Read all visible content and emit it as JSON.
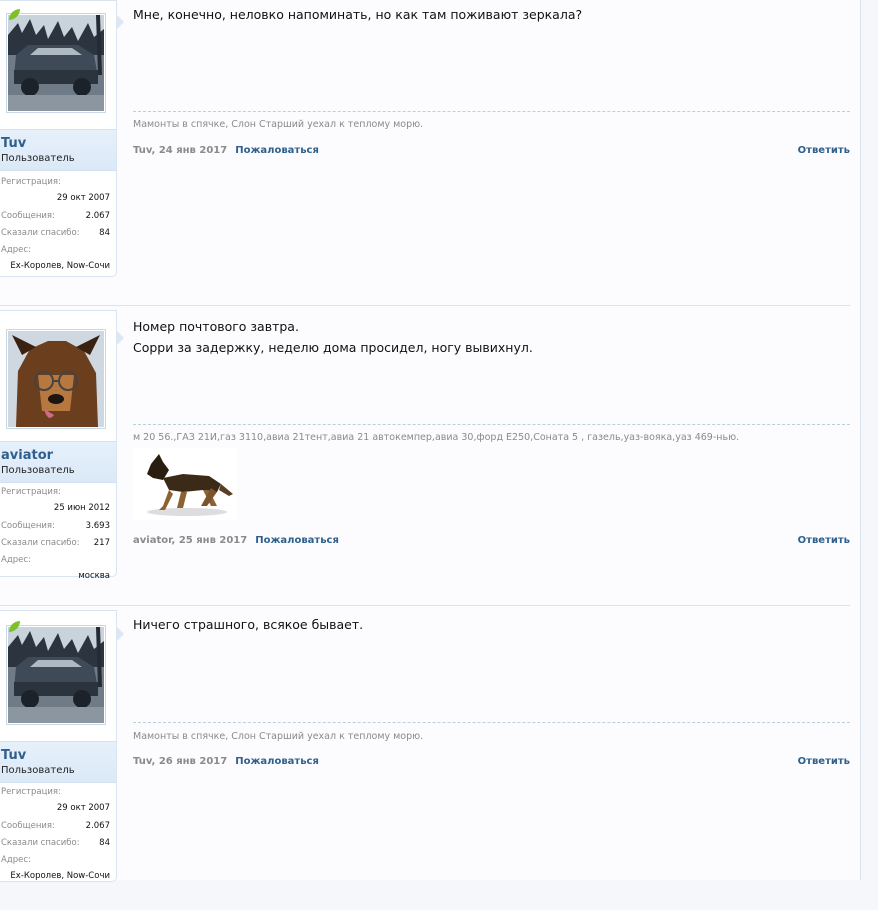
{
  "posts": [
    {
      "author": "Tuv",
      "user_title": "Пользователь",
      "online": true,
      "avatar_icon": "old-car-avatar",
      "stats": [
        {
          "label": "Регистрация:",
          "value": "29 окт 2007"
        },
        {
          "label": "Сообщения:",
          "value": "2.067"
        },
        {
          "label": "Сказали спасибо:",
          "value": "84"
        },
        {
          "label": "Адрес:",
          "value": "Ex-Королев, Now-Сочи"
        }
      ],
      "message_lines": [
        "Мне, конечно, неловко напоминать, но как там поживают зеркала?"
      ],
      "signature": "Мамонты в спячке, Слон Старший уехал к теплому морю.",
      "date": "Tuv, 24 янв 2017",
      "report": "Пожаловаться",
      "reply": "Ответить"
    },
    {
      "author": "aviator",
      "user_title": "Пользователь",
      "online": false,
      "avatar_icon": "dog-with-glasses-avatar",
      "stats": [
        {
          "label": "Регистрация:",
          "value": "25 июн 2012"
        },
        {
          "label": "Сообщения:",
          "value": "3.693"
        },
        {
          "label": "Сказали спасибо:",
          "value": "217"
        },
        {
          "label": "Адрес:",
          "value": "москва"
        }
      ],
      "message_lines": [
        "Номер почтового завтра.",
        "Сорри за задержку, неделю дома просидел, ногу вывихнул."
      ],
      "signature": "м 20 56.,ГАЗ 21И,газ 3110,авиа 21тент,авиа 21 автокемпер,авиа 30,форд Е250,Соната 5 , газель,уаз-вояка,уаз 469-нью.",
      "signature_image_icon": "running-dog-image",
      "date": "aviator, 25 янв 2017",
      "report": "Пожаловаться",
      "reply": "Ответить"
    },
    {
      "author": "Tuv",
      "user_title": "Пользователь",
      "online": true,
      "avatar_icon": "old-car-avatar",
      "stats": [
        {
          "label": "Регистрация:",
          "value": "29 окт 2007"
        },
        {
          "label": "Сообщения:",
          "value": "2.067"
        },
        {
          "label": "Сказали спасибо:",
          "value": "84"
        },
        {
          "label": "Адрес:",
          "value": "Ex-Королев, Now-Сочи"
        }
      ],
      "message_lines": [
        "Ничего страшного, всякое бывает."
      ],
      "signature": "Мамонты в спячке, Слон Старший уехал к теплому морю.",
      "date": "Tuv, 26 янв 2017",
      "report": "Пожаловаться",
      "reply": "Ответить"
    }
  ]
}
